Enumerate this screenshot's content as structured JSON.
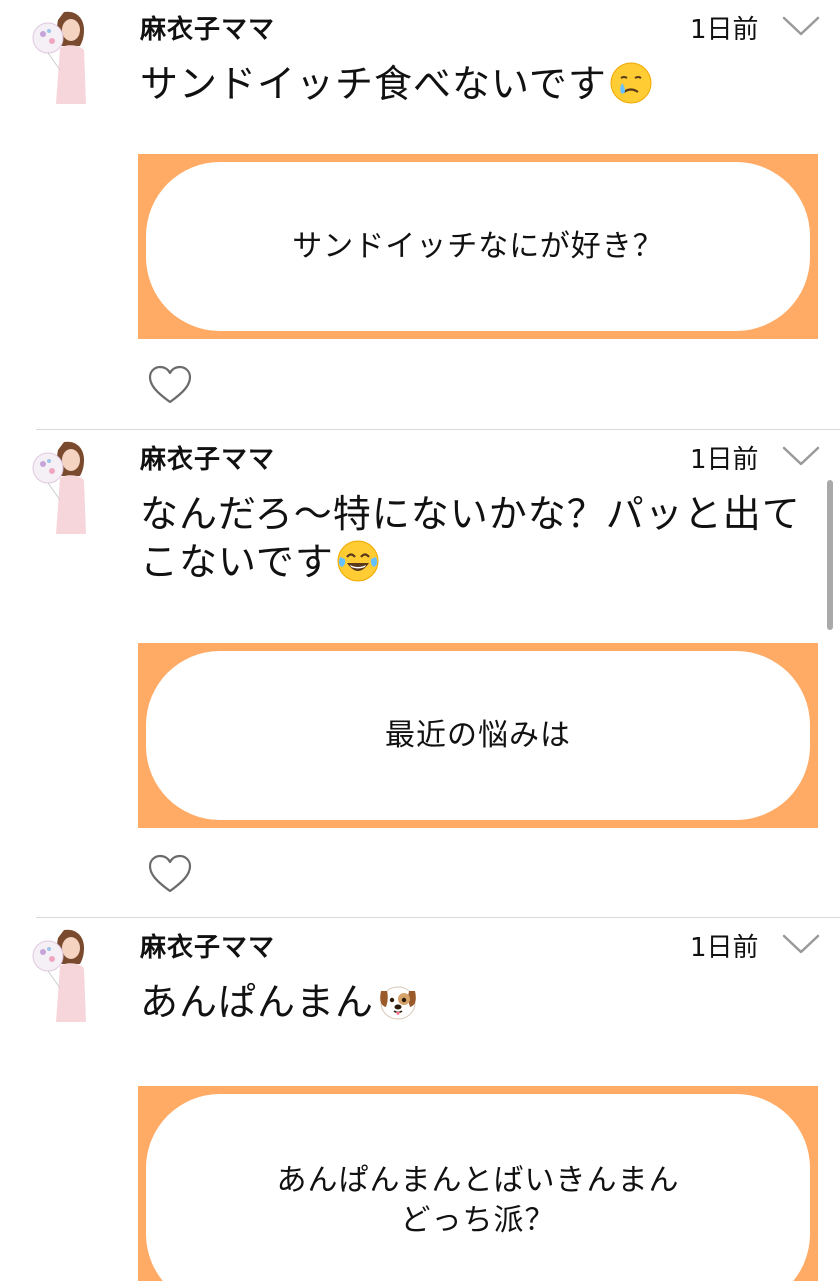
{
  "posts": [
    {
      "username": "麻衣子ママ",
      "time": "1日前",
      "text": "サンドイッチ食べないです",
      "emoji": "crying-face-emoji",
      "question": "サンドイッチなにが好き？"
    },
    {
      "username": "麻衣子ママ",
      "time": "1日前",
      "text_line1": "なんだろ〜特にないかな？パッと出て",
      "text_line2": "こないです",
      "emoji": "tears-of-joy-emoji",
      "question": "最近の悩みは"
    },
    {
      "username": "麻衣子ママ",
      "time": "1日前",
      "text": "あんぱんまん",
      "emoji": "dog-face-emoji",
      "question_line1": "あんぱんまんとばいきんまん",
      "question_line2": "どっち派？"
    }
  ],
  "colors": {
    "card_border": "#ffab66",
    "divider": "#d9d9d9",
    "scrollbar": "#a9a9a9"
  }
}
